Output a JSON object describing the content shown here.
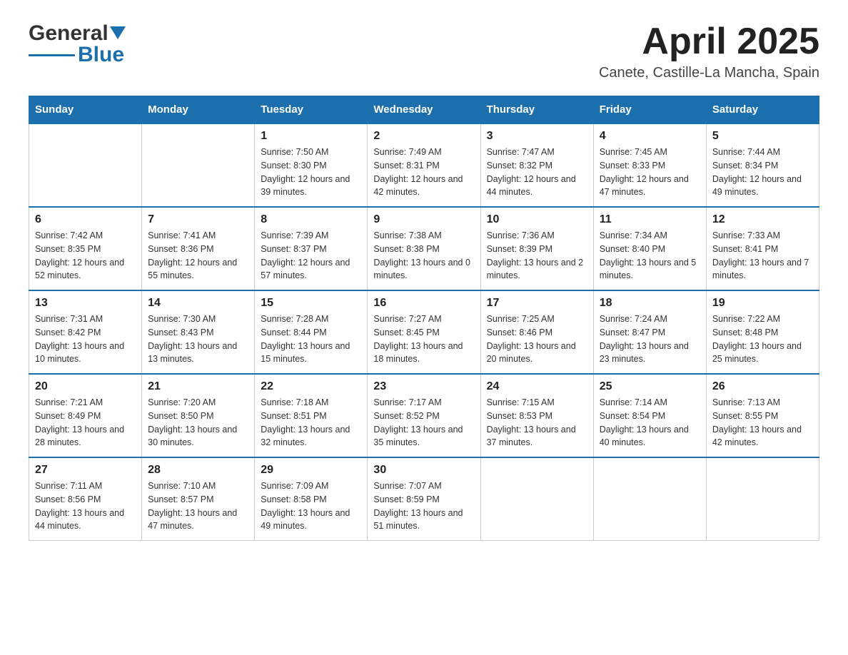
{
  "header": {
    "logo": {
      "general": "General",
      "blue": "Blue"
    },
    "title": "April 2025",
    "subtitle": "Canete, Castille-La Mancha, Spain"
  },
  "calendar": {
    "days_of_week": [
      "Sunday",
      "Monday",
      "Tuesday",
      "Wednesday",
      "Thursday",
      "Friday",
      "Saturday"
    ],
    "weeks": [
      [
        {
          "day": "",
          "sunrise": "",
          "sunset": "",
          "daylight": ""
        },
        {
          "day": "",
          "sunrise": "",
          "sunset": "",
          "daylight": ""
        },
        {
          "day": "1",
          "sunrise": "Sunrise: 7:50 AM",
          "sunset": "Sunset: 8:30 PM",
          "daylight": "Daylight: 12 hours and 39 minutes."
        },
        {
          "day": "2",
          "sunrise": "Sunrise: 7:49 AM",
          "sunset": "Sunset: 8:31 PM",
          "daylight": "Daylight: 12 hours and 42 minutes."
        },
        {
          "day": "3",
          "sunrise": "Sunrise: 7:47 AM",
          "sunset": "Sunset: 8:32 PM",
          "daylight": "Daylight: 12 hours and 44 minutes."
        },
        {
          "day": "4",
          "sunrise": "Sunrise: 7:45 AM",
          "sunset": "Sunset: 8:33 PM",
          "daylight": "Daylight: 12 hours and 47 minutes."
        },
        {
          "day": "5",
          "sunrise": "Sunrise: 7:44 AM",
          "sunset": "Sunset: 8:34 PM",
          "daylight": "Daylight: 12 hours and 49 minutes."
        }
      ],
      [
        {
          "day": "6",
          "sunrise": "Sunrise: 7:42 AM",
          "sunset": "Sunset: 8:35 PM",
          "daylight": "Daylight: 12 hours and 52 minutes."
        },
        {
          "day": "7",
          "sunrise": "Sunrise: 7:41 AM",
          "sunset": "Sunset: 8:36 PM",
          "daylight": "Daylight: 12 hours and 55 minutes."
        },
        {
          "day": "8",
          "sunrise": "Sunrise: 7:39 AM",
          "sunset": "Sunset: 8:37 PM",
          "daylight": "Daylight: 12 hours and 57 minutes."
        },
        {
          "day": "9",
          "sunrise": "Sunrise: 7:38 AM",
          "sunset": "Sunset: 8:38 PM",
          "daylight": "Daylight: 13 hours and 0 minutes."
        },
        {
          "day": "10",
          "sunrise": "Sunrise: 7:36 AM",
          "sunset": "Sunset: 8:39 PM",
          "daylight": "Daylight: 13 hours and 2 minutes."
        },
        {
          "day": "11",
          "sunrise": "Sunrise: 7:34 AM",
          "sunset": "Sunset: 8:40 PM",
          "daylight": "Daylight: 13 hours and 5 minutes."
        },
        {
          "day": "12",
          "sunrise": "Sunrise: 7:33 AM",
          "sunset": "Sunset: 8:41 PM",
          "daylight": "Daylight: 13 hours and 7 minutes."
        }
      ],
      [
        {
          "day": "13",
          "sunrise": "Sunrise: 7:31 AM",
          "sunset": "Sunset: 8:42 PM",
          "daylight": "Daylight: 13 hours and 10 minutes."
        },
        {
          "day": "14",
          "sunrise": "Sunrise: 7:30 AM",
          "sunset": "Sunset: 8:43 PM",
          "daylight": "Daylight: 13 hours and 13 minutes."
        },
        {
          "day": "15",
          "sunrise": "Sunrise: 7:28 AM",
          "sunset": "Sunset: 8:44 PM",
          "daylight": "Daylight: 13 hours and 15 minutes."
        },
        {
          "day": "16",
          "sunrise": "Sunrise: 7:27 AM",
          "sunset": "Sunset: 8:45 PM",
          "daylight": "Daylight: 13 hours and 18 minutes."
        },
        {
          "day": "17",
          "sunrise": "Sunrise: 7:25 AM",
          "sunset": "Sunset: 8:46 PM",
          "daylight": "Daylight: 13 hours and 20 minutes."
        },
        {
          "day": "18",
          "sunrise": "Sunrise: 7:24 AM",
          "sunset": "Sunset: 8:47 PM",
          "daylight": "Daylight: 13 hours and 23 minutes."
        },
        {
          "day": "19",
          "sunrise": "Sunrise: 7:22 AM",
          "sunset": "Sunset: 8:48 PM",
          "daylight": "Daylight: 13 hours and 25 minutes."
        }
      ],
      [
        {
          "day": "20",
          "sunrise": "Sunrise: 7:21 AM",
          "sunset": "Sunset: 8:49 PM",
          "daylight": "Daylight: 13 hours and 28 minutes."
        },
        {
          "day": "21",
          "sunrise": "Sunrise: 7:20 AM",
          "sunset": "Sunset: 8:50 PM",
          "daylight": "Daylight: 13 hours and 30 minutes."
        },
        {
          "day": "22",
          "sunrise": "Sunrise: 7:18 AM",
          "sunset": "Sunset: 8:51 PM",
          "daylight": "Daylight: 13 hours and 32 minutes."
        },
        {
          "day": "23",
          "sunrise": "Sunrise: 7:17 AM",
          "sunset": "Sunset: 8:52 PM",
          "daylight": "Daylight: 13 hours and 35 minutes."
        },
        {
          "day": "24",
          "sunrise": "Sunrise: 7:15 AM",
          "sunset": "Sunset: 8:53 PM",
          "daylight": "Daylight: 13 hours and 37 minutes."
        },
        {
          "day": "25",
          "sunrise": "Sunrise: 7:14 AM",
          "sunset": "Sunset: 8:54 PM",
          "daylight": "Daylight: 13 hours and 40 minutes."
        },
        {
          "day": "26",
          "sunrise": "Sunrise: 7:13 AM",
          "sunset": "Sunset: 8:55 PM",
          "daylight": "Daylight: 13 hours and 42 minutes."
        }
      ],
      [
        {
          "day": "27",
          "sunrise": "Sunrise: 7:11 AM",
          "sunset": "Sunset: 8:56 PM",
          "daylight": "Daylight: 13 hours and 44 minutes."
        },
        {
          "day": "28",
          "sunrise": "Sunrise: 7:10 AM",
          "sunset": "Sunset: 8:57 PM",
          "daylight": "Daylight: 13 hours and 47 minutes."
        },
        {
          "day": "29",
          "sunrise": "Sunrise: 7:09 AM",
          "sunset": "Sunset: 8:58 PM",
          "daylight": "Daylight: 13 hours and 49 minutes."
        },
        {
          "day": "30",
          "sunrise": "Sunrise: 7:07 AM",
          "sunset": "Sunset: 8:59 PM",
          "daylight": "Daylight: 13 hours and 51 minutes."
        },
        {
          "day": "",
          "sunrise": "",
          "sunset": "",
          "daylight": ""
        },
        {
          "day": "",
          "sunrise": "",
          "sunset": "",
          "daylight": ""
        },
        {
          "day": "",
          "sunrise": "",
          "sunset": "",
          "daylight": ""
        }
      ]
    ]
  }
}
